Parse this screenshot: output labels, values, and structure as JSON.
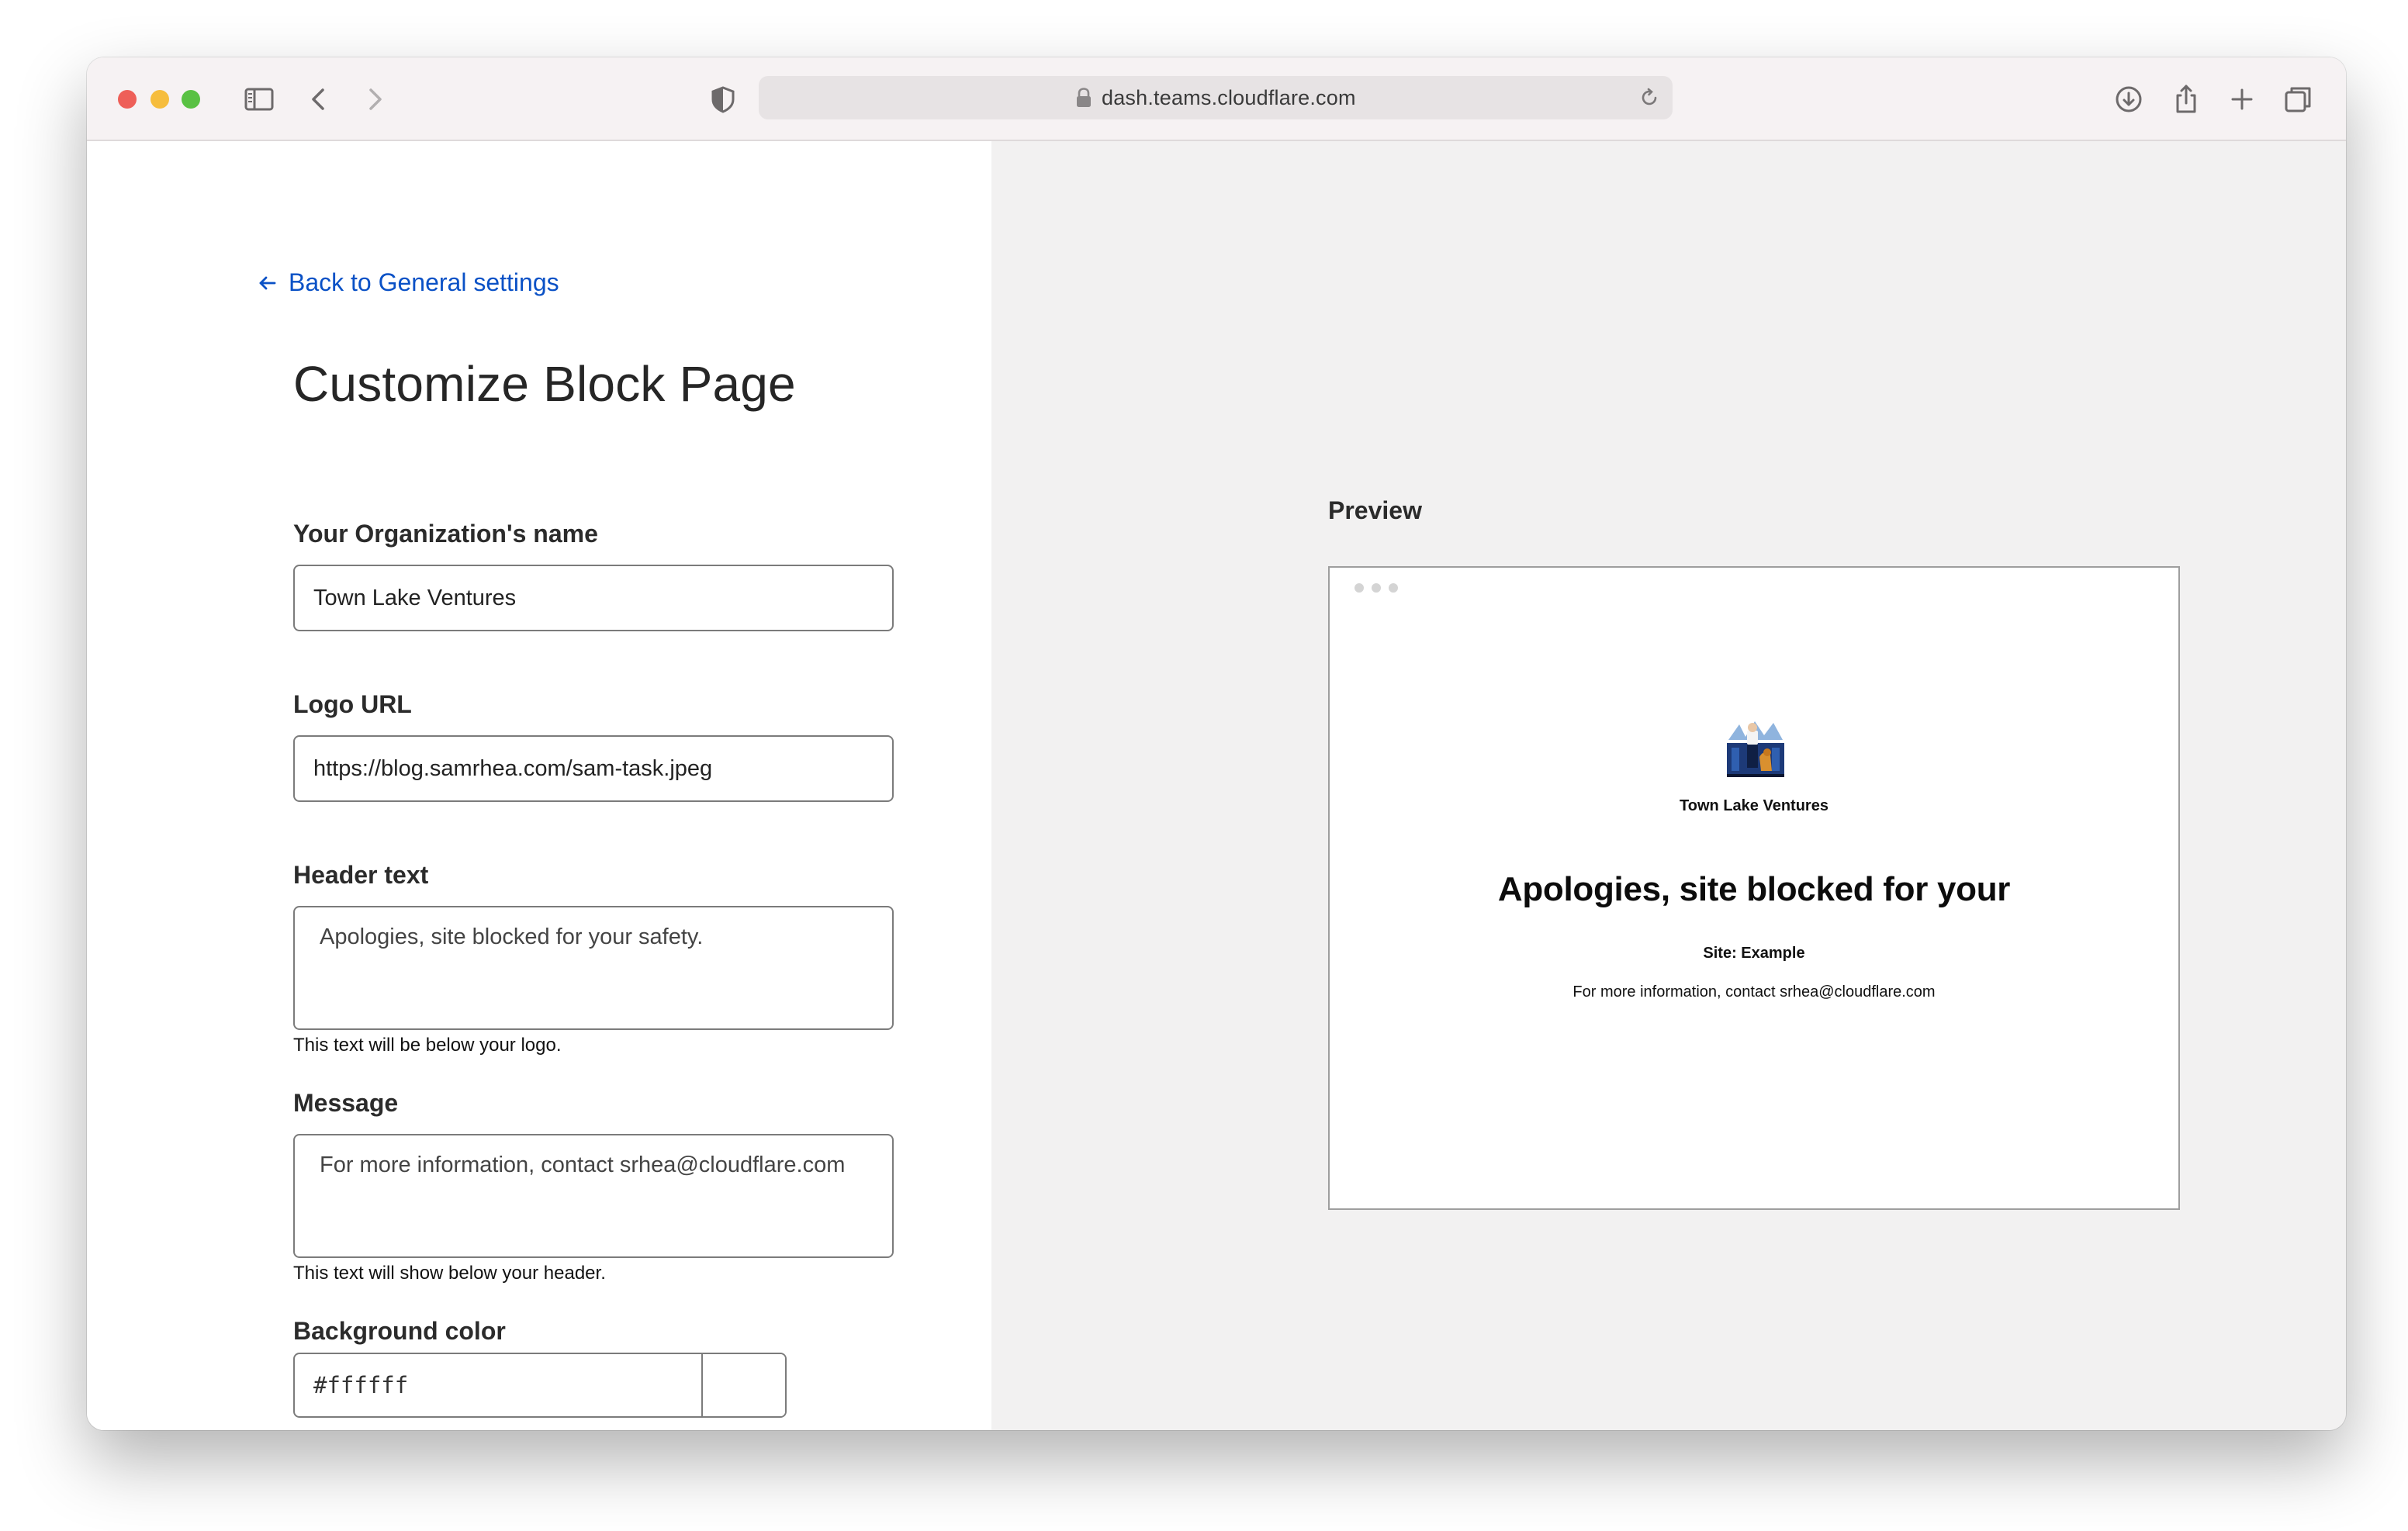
{
  "browser": {
    "url": "dash.teams.cloudflare.com",
    "icons": [
      "sidebar-icon",
      "back-icon",
      "forward-icon",
      "shield-icon",
      "lock-icon",
      "reload-icon",
      "download-icon",
      "share-icon",
      "new-tab-icon",
      "tabs-icon"
    ]
  },
  "form": {
    "back_link": "Back to General settings",
    "title": "Customize Block Page",
    "org_label": "Your Organization's name",
    "org_value": "Town Lake Ventures",
    "logo_label": "Logo URL",
    "logo_value": "https://blog.samrhea.com/sam-task.jpeg",
    "header_label": "Header text",
    "header_value": "Apologies, site blocked for your safety.",
    "header_help": "This text will be below your logo.",
    "message_label": "Message",
    "message_value": "For more information, contact srhea@cloudflare.com",
    "message_help": "This text will show below your header.",
    "bg_label": "Background color",
    "bg_value": "#ffffff"
  },
  "preview": {
    "label": "Preview",
    "org_name": "Town Lake Ventures",
    "header": "Apologies, site blocked for your",
    "site": "Site: Example",
    "message": "For more information, contact srhea@cloudflare.com"
  },
  "colors": {
    "link": "#0a51c6",
    "preview_background": "#ffffff",
    "traffic_red": "#ee5f58",
    "traffic_yellow": "#f6bd3d",
    "traffic_green": "#59c143"
  }
}
